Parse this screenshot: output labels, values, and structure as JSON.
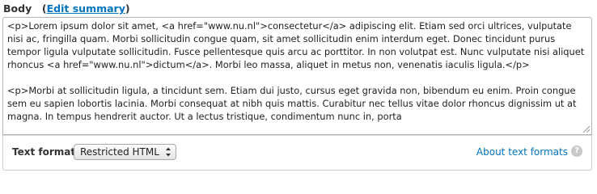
{
  "field": {
    "label": "Body",
    "edit_summary_link": "Edit summary"
  },
  "body_text": "<p>Lorem ipsum dolor sit amet, <a href=\"www.nu.nl\">consectetur</a> adipiscing elit. Etiam sed orci ultrices, vulputate nisi ac, fringilla quam. Morbi sollicitudin congue quam, sit amet sollicitudin enim interdum eget. Donec tincidunt purus tempor ligula vulputate sollicitudin. Fusce pellentesque quis arcu ac porttitor. In non volutpat est. Nunc vulputate nisi aliquet rhoncus <a href=\"www.nu.nl\">dictum</a>. Morbi leo massa, aliquet in metus non, venenatis iaculis ligula.</p>\n\n<p>Morbi at sollicitudin ligula, a tincidunt sem. Etiam dui justo, cursus eget gravida non, bibendum eu enim. Proin congue sem eu sapien lobortis lacinia. Morbi consequat at nibh quis mattis. Curabitur nec tellus vitae dolor rhoncus dignissim ut at magna. In tempus hendrerit auctor. Ut a lectus tristique, condimentum nunc in, porta",
  "text_format": {
    "label": "Text format",
    "selected": "Restricted HTML",
    "about_link": "About text formats",
    "help_icon": "question-mark-icon",
    "help_glyph": "?"
  }
}
